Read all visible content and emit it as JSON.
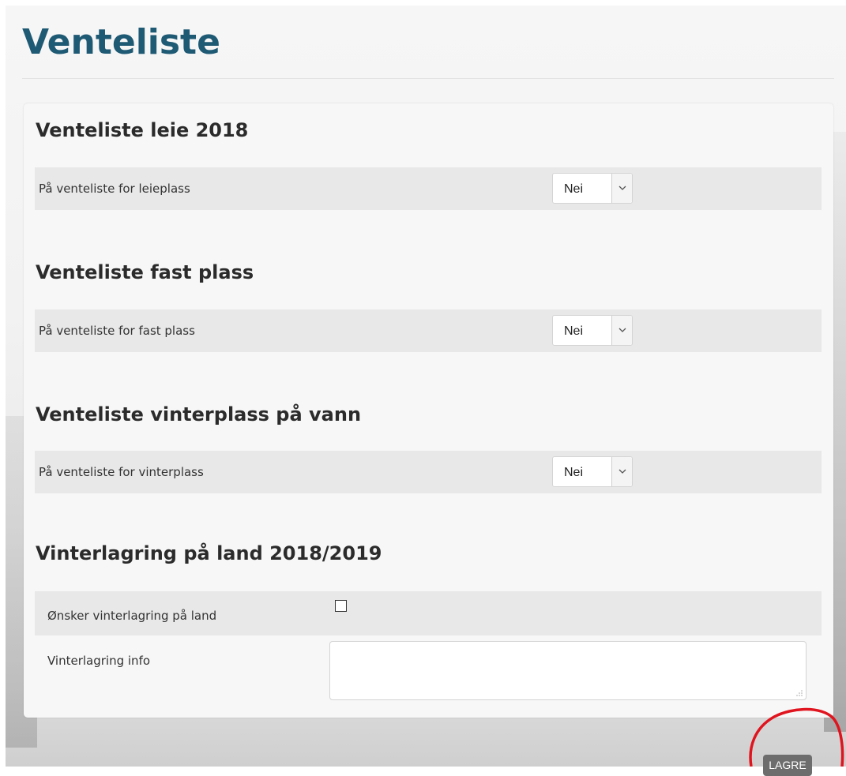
{
  "page": {
    "title": "Venteliste"
  },
  "sections": [
    {
      "heading": "Venteliste leie 2018",
      "field_label": "På venteliste for leieplass",
      "select_value": "Nei"
    },
    {
      "heading": "Venteliste fast plass",
      "field_label": "På venteliste for fast plass",
      "select_value": "Nei"
    },
    {
      "heading": "Venteliste vinterplass på vann",
      "field_label": "På venteliste for vinterplass",
      "select_value": "Nei"
    }
  ],
  "winter_storage": {
    "heading": "Vinterlagring på land 2018/2019",
    "checkbox_label": "Ønsker vinterlagring på land",
    "checkbox_checked": false,
    "info_label": "Vinterlagring info",
    "info_value": ""
  },
  "actions": {
    "save_label": "LAGRE"
  },
  "colors": {
    "title": "#1f5a74",
    "row_background": "#e8e8e8",
    "save_button": "#6d6d6d",
    "highlight": "#e0141e"
  }
}
